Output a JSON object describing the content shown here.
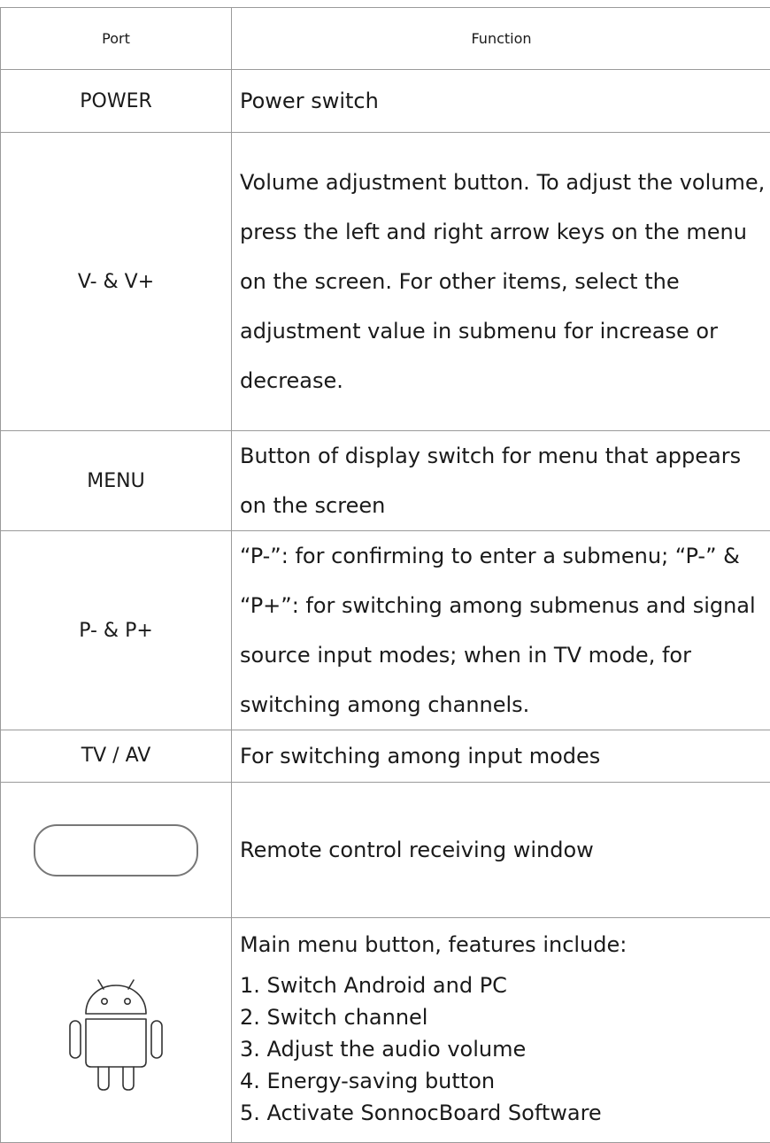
{
  "table": {
    "headers": {
      "port": "Port",
      "function": "Function"
    },
    "rows": [
      {
        "port": "POWER",
        "function": "Power switch"
      },
      {
        "port": "V- & V+",
        "function": "Volume adjustment button. To adjust the volume, press the left and right arrow keys on the menu on the screen. For other items, select the adjustment value in submenu for increase or decrease."
      },
      {
        "port": "MENU",
        "function": "Button of display switch for menu that appears on the screen"
      },
      {
        "port": "P- & P+",
        "function": "“P-”: for confirming to enter a submenu; “P-” & “P+”: for switching among submenus and signal source input modes; when in TV mode, for switching among channels."
      },
      {
        "port": "TV / AV",
        "function": "For switching among input modes"
      },
      {
        "port_icon": "remote-receiver-window-icon",
        "function": "Remote control receiving window"
      },
      {
        "port_icon": "android-icon",
        "function": "Main menu button, features include:",
        "features": [
          "1. Switch Android and PC",
          "2. Switch channel",
          "3. Adjust the audio volume",
          "4. Energy-saving button",
          "5. Activate SonnocBoard Software"
        ]
      }
    ]
  }
}
